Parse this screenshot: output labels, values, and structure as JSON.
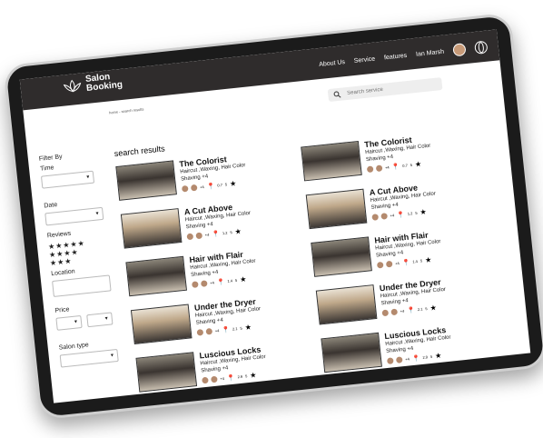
{
  "brand": {
    "line1": "Salon",
    "line2": "Booking"
  },
  "nav": {
    "about": "About Us",
    "service": "Service",
    "features": "features",
    "user": "Ian Marsh"
  },
  "breadcrumb": "home - search results",
  "search": {
    "placeholder": "Search service"
  },
  "filters": {
    "title": "Filter By",
    "time": "Time",
    "date": "Date",
    "reviews": "Reviews",
    "stars": [
      "★★★★★",
      "★★★★",
      "★★★"
    ],
    "location": "Location",
    "price": "Price",
    "salon_type": "Salon type"
  },
  "results_title": "search results",
  "results_left": [
    {
      "name": "The Colorist",
      "services": "Haircut ,Waxing, Hair Color",
      "extra": "Shaving +4",
      "more": "+4",
      "distance": "0.7",
      "rating": "5"
    },
    {
      "name": "A Cut Above",
      "services": "Haircut ,Waxing, Hair Color",
      "extra": "Shaving +4",
      "more": "+4",
      "distance": "1.2",
      "rating": "5"
    },
    {
      "name": "Hair with Flair",
      "services": "Haircut ,Waxing, Hair Color",
      "extra": "Shaving +4",
      "more": "+4",
      "distance": "1.4",
      "rating": "5"
    },
    {
      "name": "Under the Dryer",
      "services": "Haircut ,Waxing, Hair Color",
      "extra": "Shaving +4",
      "more": "+4",
      "distance": "2.1",
      "rating": "5"
    },
    {
      "name": "Luscious Locks",
      "services": "Haircut ,Waxing, Hair Color",
      "extra": "Shaving +4",
      "more": "+4",
      "distance": "2.9",
      "rating": "5"
    }
  ],
  "results_right": [
    {
      "name": "The Colorist",
      "services": "Haircut ,Waxing, Hair Color",
      "extra": "Shaving +4",
      "more": "+4",
      "distance": "0.7",
      "rating": "5"
    },
    {
      "name": "A Cut Above",
      "services": "Haircut ,Waxing, Hair Color",
      "extra": "Shaving +4",
      "more": "+4",
      "distance": "1.2",
      "rating": "5"
    },
    {
      "name": "Hair with Flair",
      "services": "Haircut ,Waxing, Hair Color",
      "extra": "Shaving +4",
      "more": "+4",
      "distance": "1.4",
      "rating": "5"
    },
    {
      "name": "Under the Dryer",
      "services": "Haircut ,Waxing, Hair Color",
      "extra": "Shaving +4",
      "more": "+4",
      "distance": "2.1",
      "rating": "5"
    },
    {
      "name": "Luscious Locks",
      "services": "Haircut ,Waxing, Hair Color",
      "extra": "Shaving +4",
      "more": "+4",
      "distance": "2.9",
      "rating": "5"
    }
  ]
}
